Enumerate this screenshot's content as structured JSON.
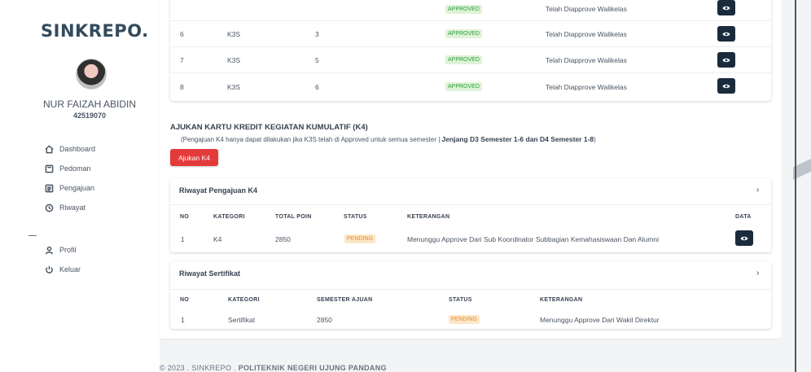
{
  "sidebar": {
    "logo": "SINKREPO.",
    "user_name": "NUR FAIZAH ABIDIN",
    "user_nim": "42519070",
    "nav": [
      {
        "label": "Dashboard",
        "icon": "home-icon"
      },
      {
        "label": "Pedoman",
        "icon": "book-icon"
      },
      {
        "label": "Pengajuan",
        "icon": "list-icon"
      },
      {
        "label": "Riwayat",
        "icon": "history-icon"
      },
      {
        "label": "Profil",
        "icon": "user-icon"
      },
      {
        "label": "Keluar",
        "icon": "power-icon"
      }
    ]
  },
  "k3s_table": {
    "partial_row": {
      "status": "APPROVED",
      "keterangan": "Telah Diapprove Walikelas"
    },
    "rows": [
      {
        "no": "6",
        "kategori": "K3S",
        "semester": "3",
        "status": "APPROVED",
        "keterangan": "Telah Diapprove Walikelas"
      },
      {
        "no": "7",
        "kategori": "K3S",
        "semester": "5",
        "status": "APPROVED",
        "keterangan": "Telah Diapprove Walikelas"
      },
      {
        "no": "8",
        "kategori": "K3S",
        "semester": "6",
        "status": "APPROVED",
        "keterangan": "Telah Diapprove Walikelas"
      }
    ]
  },
  "k4_section": {
    "title": "AJUKAN KARTU KREDIT KEGIATAN KUMULATIF (K4)",
    "note": "(Pengajuan K4 hanya dapat dilakukan jika K3S telah di Approved untuk semua semester |",
    "note_bold": "Jenjang D3 Semester 1-6 dan D4 Semester 1-8",
    "note_end": ")",
    "button_label": "Ajukan K4"
  },
  "riwayat_k4": {
    "title": "Riwayat Pengajuan K4",
    "headers": [
      "NO",
      "KATEGORI",
      "TOTAL POIN",
      "STATUS",
      "KETERANGAN",
      "DATA"
    ],
    "rows": [
      {
        "no": "1",
        "kategori": "K4",
        "total_poin": "2850",
        "status": "PENDING",
        "keterangan": "Menunggu Approve Dari Sub Koordinator Subbagian Kemahasiswaan Dan Alumni"
      }
    ]
  },
  "riwayat_sertifikat": {
    "title": "Riwayat Sertifikat",
    "headers": [
      "NO",
      "KATEGORI",
      "SEMESTER AJUAN",
      "STATUS",
      "KETERANGAN"
    ],
    "rows": [
      {
        "no": "1",
        "kategori": "Sertifikat",
        "semester_ajuan": "2850",
        "status": "PENDING",
        "keterangan": "Menunggu Approve Dari Wakil Direktur"
      }
    ]
  },
  "footer": {
    "text": "© 2023 . SINKREPO .",
    "institution": "POLITEKNIK NEGERI UJUNG PANDANG"
  },
  "colors": {
    "brand_dark": "#1b2b3c",
    "danger": "#e53a3a",
    "approved_text": "#2e9d3e",
    "approved_bg": "#dff3d6",
    "pending_text": "#f08a24",
    "pending_bg": "#fde7c8"
  }
}
